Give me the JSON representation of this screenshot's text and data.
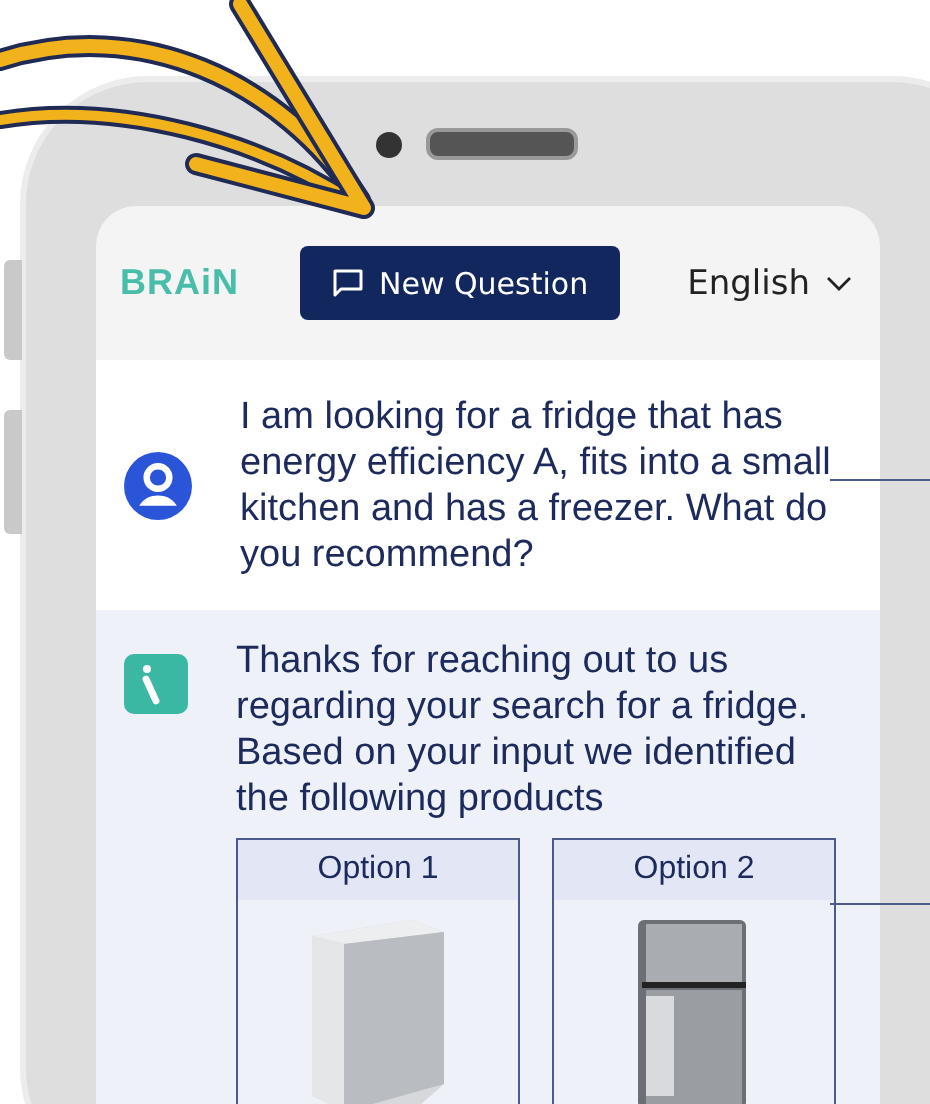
{
  "header": {
    "logo": "BRAiN",
    "new_question_button": "New Question",
    "language": "English"
  },
  "messages": [
    {
      "kind": "user",
      "text": "I am looking for a fridge that has energy efficiency A, fits into a small kitchen and has a freezer. What do you recommend?"
    },
    {
      "kind": "bot",
      "text": "Thanks for reaching out to us regarding your search for a fridge. Based on your input we identified the following products"
    }
  ],
  "options": [
    {
      "label": "Option 1",
      "kind": "single-door"
    },
    {
      "label": "Option 2",
      "kind": "double-door"
    }
  ]
}
